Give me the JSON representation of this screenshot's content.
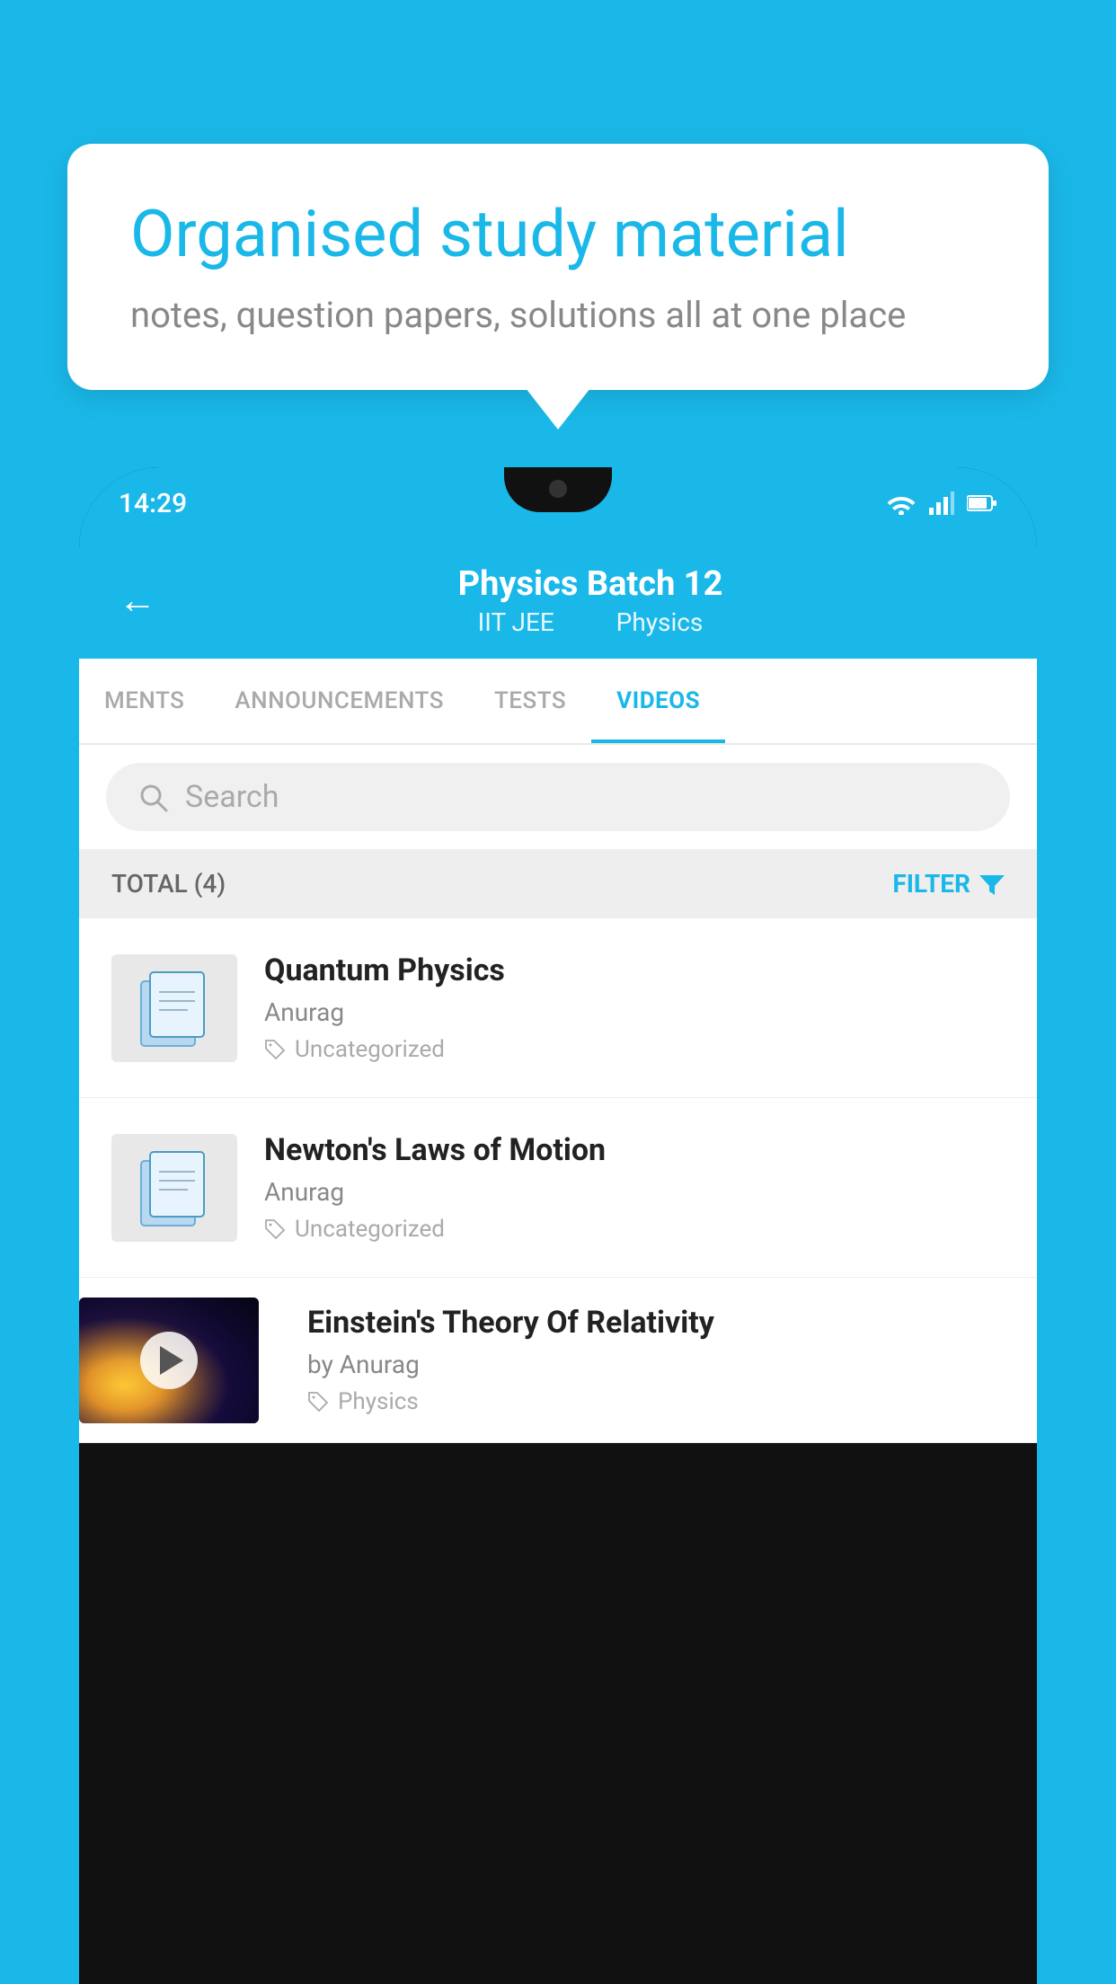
{
  "background_color": "#1ab8e8",
  "speech_bubble": {
    "title": "Organised study material",
    "subtitle": "notes, question papers, solutions all at one place"
  },
  "status_bar": {
    "time": "14:29",
    "icons": [
      "wifi",
      "signal",
      "battery"
    ]
  },
  "app_header": {
    "back_label": "←",
    "title": "Physics Batch 12",
    "subtitle_parts": [
      "IIT JEE",
      "Physics"
    ]
  },
  "tabs": [
    {
      "label": "MENTS",
      "active": false
    },
    {
      "label": "ANNOUNCEMENTS",
      "active": false
    },
    {
      "label": "TESTS",
      "active": false
    },
    {
      "label": "VIDEOS",
      "active": true
    }
  ],
  "search": {
    "placeholder": "Search"
  },
  "filter_bar": {
    "total_label": "TOTAL (4)",
    "filter_label": "FILTER"
  },
  "videos": [
    {
      "title": "Quantum Physics",
      "author": "Anurag",
      "tag": "Uncategorized",
      "type": "file"
    },
    {
      "title": "Newton's Laws of Motion",
      "author": "Anurag",
      "tag": "Uncategorized",
      "type": "file"
    },
    {
      "title": "Einstein's Theory Of Relativity",
      "author": "by Anurag",
      "tag": "Physics",
      "type": "video"
    }
  ]
}
